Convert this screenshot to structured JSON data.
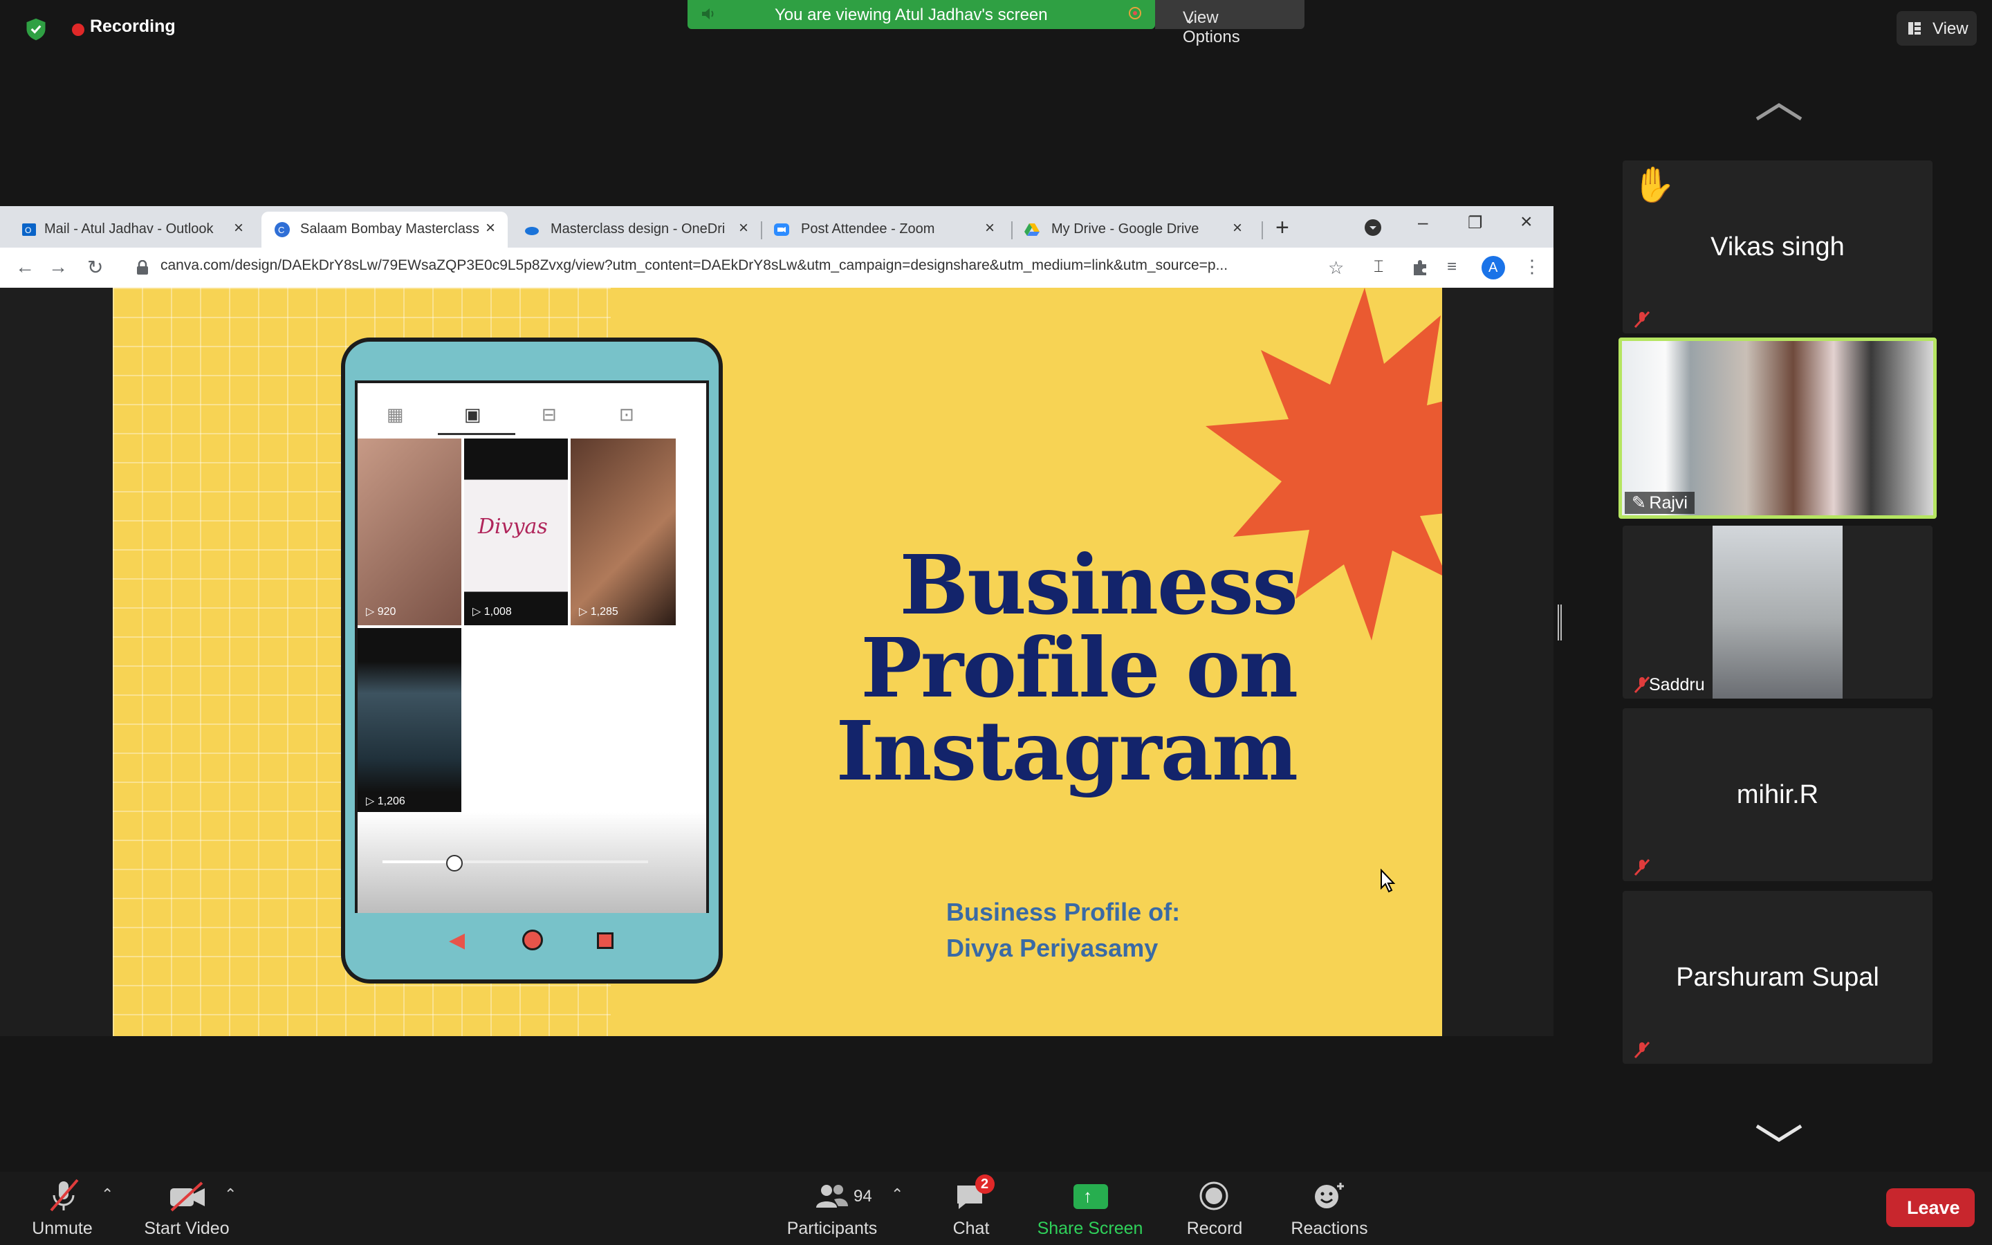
{
  "top": {
    "recording_label": "Recording",
    "share_banner_text": "You are viewing Atul Jadhav's screen",
    "view_options_label": "View Options",
    "view_label": "View"
  },
  "browser": {
    "tabs": [
      {
        "label": "Mail - Atul Jadhav - Outlook"
      },
      {
        "label": "Salaam Bombay Masterclass"
      },
      {
        "label": "Masterclass design - OneDri"
      },
      {
        "label": "Post Attendee - Zoom"
      },
      {
        "label": "My Drive - Google Drive"
      }
    ],
    "url": "canva.com/design/DAEkDrY8sLw/79EWsaZQP3E0c9L5p8Zvxg/view?utm_content=DAEkDrY8sLw&utm_campaign=designshare&utm_medium=link&utm_source=p...",
    "profile_initial": "A"
  },
  "slide": {
    "title_lines": [
      "Business",
      "Profile on",
      "Instagram"
    ],
    "subtitle_lines": [
      "Business Profile of:",
      "Divya Periyasamy"
    ],
    "thumb_views": [
      "920",
      "1,008",
      "1,285",
      "1,206"
    ],
    "thumb_brand": "Divyas"
  },
  "participants": [
    {
      "name": "Vikas singh"
    },
    {
      "name": "Rajvi"
    },
    {
      "name": "Saddru"
    },
    {
      "name": "mihir.R"
    },
    {
      "name": "Parshuram Supal"
    }
  ],
  "toolbar": {
    "unmute": "Unmute",
    "start_video": "Start Video",
    "participants": "Participants",
    "participants_count": "94",
    "chat": "Chat",
    "chat_badge": "2",
    "share_screen": "Share Screen",
    "record": "Record",
    "reactions": "Reactions",
    "leave": "Leave"
  },
  "colors": {
    "share_green": "#2fa043",
    "slide_yellow": "#f7d354",
    "title_navy": "#13246b",
    "leave_red": "#c8262d"
  }
}
